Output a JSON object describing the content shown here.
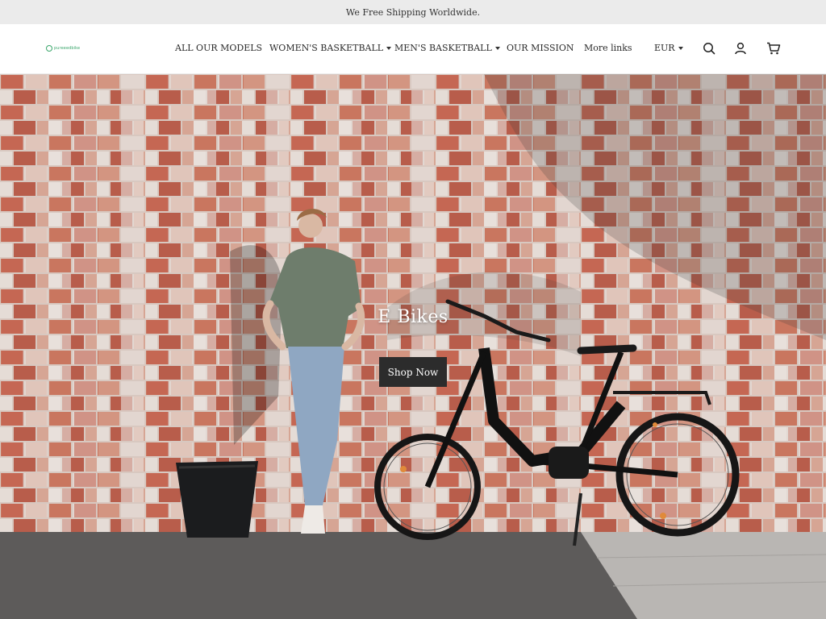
{
  "announcement": "We Free Shipping Worldwide.",
  "logo": {
    "text": "pureeedbike"
  },
  "nav": {
    "items": [
      {
        "label": "ALL OUR MODELS",
        "dropdown": false
      },
      {
        "label": "WOMEN'S BASKETBALL",
        "dropdown": true
      },
      {
        "label": "MEN'S BASKETBALL",
        "dropdown": true
      },
      {
        "label": "OUR MISSION",
        "dropdown": false
      },
      {
        "label": "More links",
        "dropdown": false
      }
    ],
    "currency": "EUR"
  },
  "icons": {
    "search": "search-icon",
    "account": "user-icon",
    "cart": "cart-icon"
  },
  "hero": {
    "title": "E Bikes",
    "button_label": "Shop Now"
  },
  "colors": {
    "brand": "#3aa66b",
    "button": "#2c2c2c",
    "announce_bg": "#ebebeb"
  }
}
